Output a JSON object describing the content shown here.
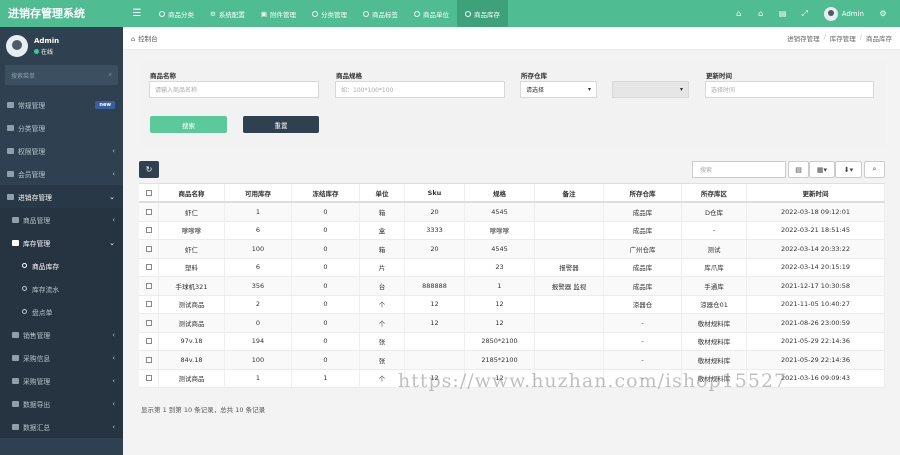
{
  "app": {
    "title": "进销存管理系统"
  },
  "header": {
    "tabs": [
      {
        "label": "商品分类",
        "active": false
      },
      {
        "label": "系统配置",
        "active": false
      },
      {
        "label": "附件管理",
        "active": false
      },
      {
        "label": "分类管理",
        "active": false
      },
      {
        "label": "商品标签",
        "active": false
      },
      {
        "label": "商品单位",
        "active": false
      },
      {
        "label": "商品库存",
        "active": true
      }
    ],
    "user": "Admin"
  },
  "sidebar": {
    "user": {
      "name": "Admin",
      "status": "在线"
    },
    "search_placeholder": "搜索菜单",
    "items": [
      {
        "label": "常规管理",
        "badge": "new"
      },
      {
        "label": "分类管理"
      },
      {
        "label": "权限管理"
      },
      {
        "label": "会员管理"
      },
      {
        "label": "进销存管理"
      },
      {
        "label": "商品管理"
      },
      {
        "label": "库存管理"
      },
      {
        "label": "商品库存"
      },
      {
        "label": "库存流水"
      },
      {
        "label": "盘点单"
      },
      {
        "label": "销售管理"
      },
      {
        "label": "采购信息"
      },
      {
        "label": "采购管理"
      },
      {
        "label": "数据导出"
      },
      {
        "label": "数据汇总"
      }
    ]
  },
  "breadcrumb": {
    "page": "控制台",
    "path": [
      "进销存管理",
      "库存管理",
      "商品库存"
    ]
  },
  "filters": {
    "name_label": "商品名称",
    "name_placeholder": "请输入商品名称",
    "spec_label": "商品规格",
    "spec_placeholder": "如：100*100*100",
    "wh_label": "所存仓库",
    "wh_value": "请选择",
    "time_label": "更新时间",
    "time_placeholder": "选择时间",
    "search_btn": "搜索",
    "reset_btn": "重置"
  },
  "toolbar": {
    "search_placeholder": "搜索"
  },
  "table": {
    "headers": [
      "商品名称",
      "可用库存",
      "冻结库存",
      "单位",
      "Sku",
      "规格",
      "备注",
      "所存仓库",
      "所存库区",
      "更新时间"
    ],
    "rows": [
      [
        "虾仁",
        "1",
        "0",
        "箱",
        "20",
        "4545",
        "",
        "成品库",
        "D仓库",
        "2022-03-18 09:12:01"
      ],
      [
        "嗲嗲嗲",
        "6",
        "0",
        "盒",
        "3333",
        "嗲嗲嗲",
        "",
        "成品库",
        "-",
        "2022-03-21 18:51:45"
      ],
      [
        "虾仁",
        "100",
        "0",
        "箱",
        "20",
        "4545",
        "",
        "广州仓库",
        "测试",
        "2022-03-14 20:33:22"
      ],
      [
        "塑料",
        "6",
        "0",
        "片",
        "",
        "23",
        "报警器",
        "成品库",
        "库爪库",
        "2022-03-14 20:15:19"
      ],
      [
        "手球机321",
        "356",
        "0",
        "台",
        "888888",
        "1",
        "报警器 监视",
        "成品库",
        "手通库",
        "2021-12-17 10:30:58"
      ],
      [
        "测试商品",
        "2",
        "0",
        "个",
        "12",
        "12",
        "",
        "涼器仓",
        "涼器仓01",
        "2021-11-05 10:40:27"
      ],
      [
        "测试商品",
        "0",
        "0",
        "个",
        "12",
        "12",
        "",
        "-",
        "敬材规料库",
        "2021-08-26 23:00:59"
      ],
      [
        "97v.18",
        "194",
        "0",
        "张",
        "",
        "2850*2100",
        "",
        "-",
        "敬材规料库",
        "2021-05-29 22:14:36"
      ],
      [
        "84v.18",
        "100",
        "0",
        "张",
        "",
        "2185*2100",
        "",
        "-",
        "敬材规料库",
        "2021-05-29 22:14:36"
      ],
      [
        "测试商品",
        "1",
        "1",
        "个",
        "12",
        "12",
        "",
        "-",
        "敬材规料库",
        "2021-03-16 09:09:43"
      ]
    ],
    "footer": "显示第 1 到第 10 条记录，总共 10 条记录"
  },
  "watermark": "https://www.huzhan.com/ishop15527"
}
